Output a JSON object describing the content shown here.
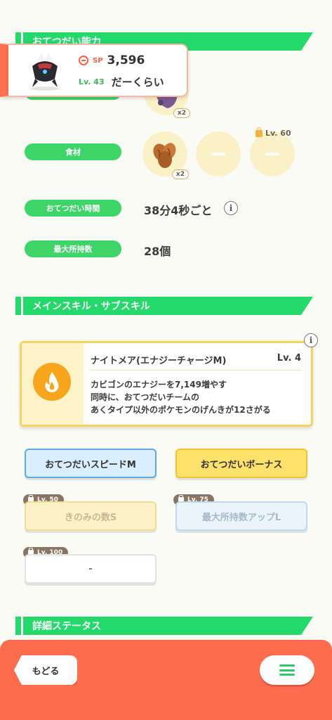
{
  "sections": {
    "help_ability": "おてつだい能力",
    "skills": "メインスキル・サブスキル",
    "details": "詳細ステータス"
  },
  "header": {
    "sp_label": "SP",
    "sp_value": "3,596",
    "level": "Lv. 43",
    "nickname": "だーくらい"
  },
  "berry": {
    "count": "x2"
  },
  "ingredients": {
    "label": "食材",
    "first_count": "x2",
    "locked_level": "Lv. 60"
  },
  "help_time": {
    "label": "おてつだい時間",
    "value": "38分4秒ごと"
  },
  "max_carry": {
    "label": "最大所持数",
    "value": "28個"
  },
  "main_skill": {
    "name": "ナイトメア(エナジーチャージM)",
    "level": "Lv. 4",
    "desc_line1": "カビゴンのエナジーを7,149増やす",
    "desc_line2": "同時に、おてつだいチームの",
    "desc_line3": "あくタイプ以外のポケモンのげんきが12さがる"
  },
  "sub_skills": [
    {
      "label": "おてつだいスピードM",
      "lock": ""
    },
    {
      "label": "おてつだいボーナス",
      "lock": ""
    },
    {
      "label": "きのみの数S",
      "lock": "Lv. 50"
    },
    {
      "label": "最大所持数アップL",
      "lock": "Lv. 75"
    },
    {
      "label": "-",
      "lock": "Lv. 100"
    }
  ],
  "footer": {
    "back_label": "もどる"
  },
  "colors": {
    "accent_green": "#22d96a",
    "footer": "#ff6b4d",
    "skill_gold": "#f7d25f"
  }
}
